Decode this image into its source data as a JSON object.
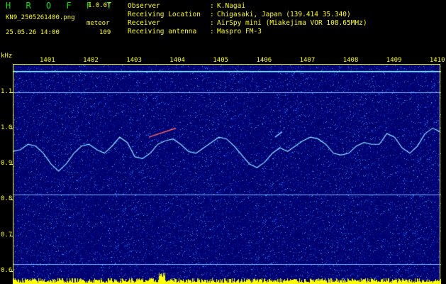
{
  "logo": "H R O F F T",
  "version": "1.0.0f",
  "file_name": "KN9_2505261400.png",
  "timestamp": "25.05.26 14:00",
  "mode_label": "meteor",
  "count": "109",
  "info": [
    {
      "label": "Observer",
      "value": "K.Nagai"
    },
    {
      "label": "Receiving Location",
      "value": "Chigasaki, Japan (139.414 35.340)"
    },
    {
      "label": "Receiver",
      "value": "AirSpy mini (Miakejima VOR 108.65MHz)"
    },
    {
      "label": "Receiving antenna",
      "value": "Maspro FM-3"
    }
  ],
  "separator": ":",
  "y_unit": "kHz",
  "colors": {
    "background": "#000000",
    "text": "#ffff00",
    "logo": "#00e600",
    "spectrum_bg": "#00006e",
    "trace": "#8ee6ff",
    "level_bar": "#ffff00"
  },
  "chart_data": {
    "type": "heatmap",
    "x_label_unit": "time (HHMM)",
    "x_ticks": [
      "1401",
      "1402",
      "1403",
      "1404",
      "1405",
      "1406",
      "1407",
      "1408",
      "1409",
      "1410"
    ],
    "y_ticks": [
      "1.1",
      "1.0",
      "0.9",
      "0.8",
      "0.7",
      "0.6"
    ],
    "ylim": [
      0.6,
      1.16
    ],
    "horizontal_lines_khz": [
      1.16,
      1.1,
      0.815,
      0.62
    ],
    "trace_khz": [
      0.935,
      0.94,
      0.955,
      0.95,
      0.93,
      0.9,
      0.88,
      0.9,
      0.93,
      0.95,
      0.955,
      0.94,
      0.93,
      0.95,
      0.975,
      0.96,
      0.92,
      0.915,
      0.93,
      0.955,
      0.965,
      0.97,
      0.955,
      0.935,
      0.93,
      0.945,
      0.96,
      0.975,
      0.97,
      0.95,
      0.925,
      0.9,
      0.89,
      0.905,
      0.93,
      0.945,
      0.935,
      0.95,
      0.965,
      0.975,
      0.97,
      0.955,
      0.93,
      0.925,
      0.93,
      0.95,
      0.96,
      0.955,
      0.955,
      0.985,
      0.975,
      0.945,
      0.93,
      0.95,
      0.985,
      1.0,
      0.99
    ]
  }
}
